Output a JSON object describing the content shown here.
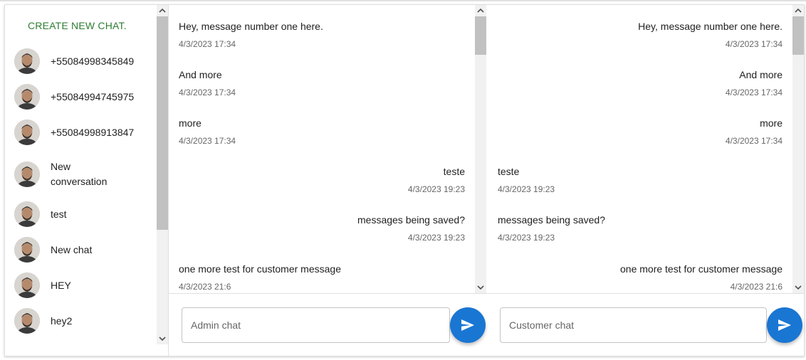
{
  "sidebar": {
    "create_label": "CREATE NEW CHAT.",
    "chats": [
      {
        "label": "+55084998345849"
      },
      {
        "label": "+55084994745975"
      },
      {
        "label": "+55084998913847"
      },
      {
        "label": "New conversation"
      },
      {
        "label": "test"
      },
      {
        "label": "New chat"
      },
      {
        "label": "HEY"
      },
      {
        "label": "hey2"
      }
    ]
  },
  "admin_panel": {
    "messages": [
      {
        "text": "Hey, message number one here.",
        "time": "4/3/2023 17:34",
        "side": "left"
      },
      {
        "text": "And more",
        "time": "4/3/2023 17:34",
        "side": "left"
      },
      {
        "text": "more",
        "time": "4/3/2023 17:34",
        "side": "left"
      },
      {
        "text": "teste",
        "time": "4/3/2023 19:23",
        "side": "right"
      },
      {
        "text": "messages being saved?",
        "time": "4/3/2023 19:23",
        "side": "right"
      },
      {
        "text": "one more test for customer message",
        "time": "4/3/2023 21:6",
        "side": "left"
      }
    ],
    "input_placeholder": "Admin chat"
  },
  "customer_panel": {
    "messages": [
      {
        "text": "Hey, message number one here.",
        "time": "4/3/2023 17:34",
        "side": "right"
      },
      {
        "text": "And more",
        "time": "4/3/2023 17:34",
        "side": "right"
      },
      {
        "text": "more",
        "time": "4/3/2023 17:34",
        "side": "right"
      },
      {
        "text": "teste",
        "time": "4/3/2023 19:23",
        "side": "left"
      },
      {
        "text": "messages being saved?",
        "time": "4/3/2023 19:23",
        "side": "left"
      },
      {
        "text": "one more test for customer message",
        "time": "4/3/2023 21:6",
        "side": "right"
      }
    ],
    "input_placeholder": "Customer chat"
  },
  "icons": {
    "send": "send-icon",
    "avatar": "user-avatar",
    "scroll_up": "chevron-up-icon",
    "scroll_down": "chevron-down-icon"
  },
  "colors": {
    "accent": "#1976d2",
    "create_text": "#2e7d32",
    "timestamp": "#666666"
  }
}
